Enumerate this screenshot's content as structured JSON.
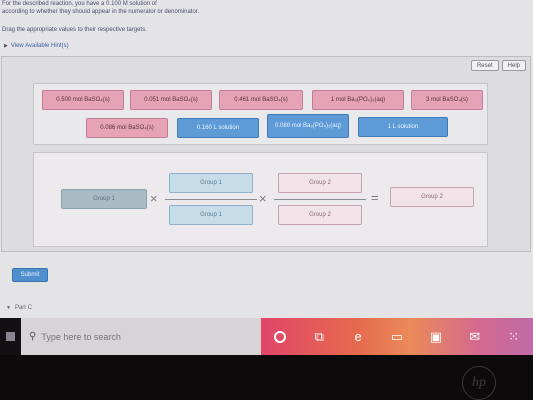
{
  "intro": {
    "line1": "For the described reaction, you have a 0.100 M solution of",
    "line2": "according to whether they should appear in the numerator or denominator.",
    "drag_instruction": "Drag the appropriate values to their respective targets."
  },
  "hints": {
    "label": "View Available Hint(s)"
  },
  "toolbar": {
    "reset_label": "Reset",
    "help_label": "Help"
  },
  "bank_tiles": [
    {
      "label": "0.500 mol  BaSO₄(s)",
      "color": "pink"
    },
    {
      "label": "0.051 mol  BaSO₄(s)",
      "color": "pink"
    },
    {
      "label": "0.461 mol  BaSO₄(s)",
      "color": "pink"
    },
    {
      "label": "1 mol  Ba₃(PO₄)₂(aq)",
      "color": "pink"
    },
    {
      "label": "3 mol  BaSO₄(s)",
      "color": "pink"
    },
    {
      "label": "0.086 mol  BaSO₄(s)",
      "color": "pink"
    },
    {
      "label": "0.160 L solution",
      "color": "blue"
    },
    {
      "label": "0.080 mol Ba₃(PO₄)₂(aq)",
      "color": "blue"
    },
    {
      "label": "1 L solution",
      "color": "blue"
    }
  ],
  "workspace": {
    "left_slot": "Group 1",
    "frac1_numerator": "Group 1",
    "frac1_denominator": "Group 1",
    "frac2_numerator": "Group 2",
    "frac2_denominator": "Group 2",
    "result_slot": "Group 2",
    "times_symbol": "×",
    "equals_symbol": "="
  },
  "submit": {
    "label": "Submit"
  },
  "part": {
    "label": "Part C"
  },
  "taskbar": {
    "search_placeholder": "Type here to search",
    "gradient_colors": [
      "#e2456a",
      "#e56a4d",
      "#eb8a5a",
      "#d36a8e",
      "#c06aa8"
    ]
  },
  "bezel": {
    "logo": "hp"
  }
}
